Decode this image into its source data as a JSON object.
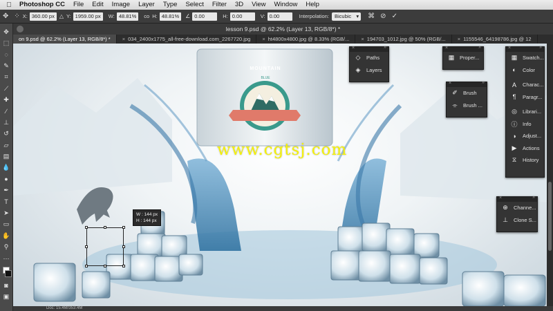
{
  "menubar": {
    "app": "Photoshop CC",
    "items": [
      "File",
      "Edit",
      "Image",
      "Layer",
      "Type",
      "Select",
      "Filter",
      "3D",
      "View",
      "Window",
      "Help"
    ]
  },
  "options": {
    "x_label": "X:",
    "x_value": "360.00 px",
    "y_label": "Y:",
    "y_value": "1959.00 px",
    "w_label": "W:",
    "w_value": "48.81%",
    "link_label": "co",
    "h_label": "H:",
    "h_value": "48.81%",
    "angle_value": "0.00",
    "hskew_label": "H:",
    "hskew_value": "0.00",
    "vskew_label": "V:",
    "vskew_value": "0.00",
    "interp_label": "Interpolation:",
    "interp_value": "Bicubic"
  },
  "document": {
    "title": "lesson 9.psd @ 62.2% (Layer 13, RGB/8*) *",
    "tabs": [
      "on 9.psd @ 62.2% (Layer 13, RGB/8*) *",
      "034_2400x1775_all-free-download.com_2267720.jpg",
      "ht4800x4800.jpg @ 8.33% (RGB/...",
      "194703_1012.jpg @ 50% (RGB/...",
      "1155546_64198786.jpg @ 12"
    ],
    "status": "Doc: 15.4M/353.4M"
  },
  "canvas": {
    "watermark": "www.cgtsj.com",
    "transform_w": "W : 144 px",
    "transform_h": "H : 144 px",
    "logo_banner": "MOUNTAIN",
    "logo_sub": "BLUE"
  },
  "panels": {
    "group1": [
      "Paths",
      "Layers"
    ],
    "group2": [
      "Proper..."
    ],
    "group3": [
      "Brush",
      "Brush ..."
    ],
    "group4": [
      "Swatch...",
      "Color",
      "Charac...",
      "Paragr...",
      "Librari...",
      "Info",
      "Adjust...",
      "Actions",
      "History"
    ],
    "group5": [
      "Channe...",
      "Clone S..."
    ]
  },
  "colors": {
    "watermark": "#f4f10a",
    "logo_teal": "#3a9a8c",
    "logo_ribbon": "#e07a6a"
  }
}
